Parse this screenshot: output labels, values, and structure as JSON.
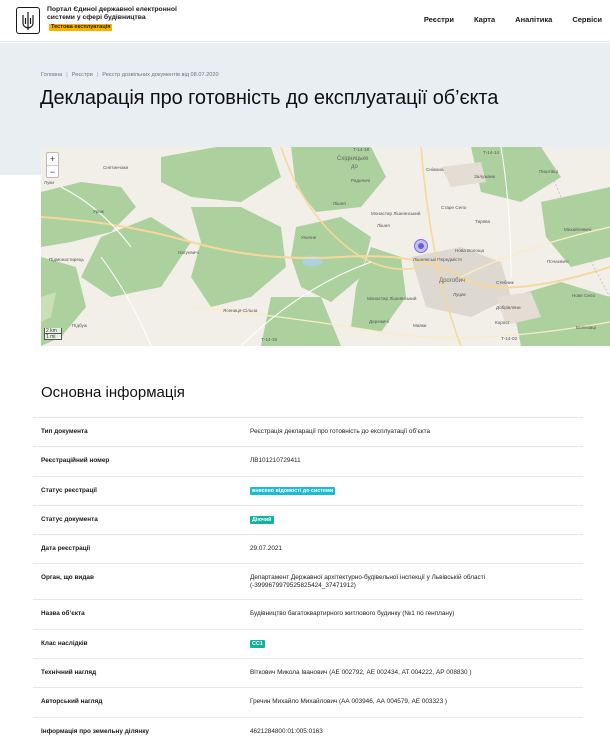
{
  "header": {
    "portal_title": "Портал Єдиної державної електронної системи у сфері будівництва",
    "test_badge": "Тестова експлуатація",
    "nav": [
      "Реєстри",
      "Карта",
      "Аналітика",
      "Сервіси"
    ]
  },
  "breadcrumb": [
    "Головна",
    "Реєстри",
    "Реєстр дозвільних документів від 08.07.2020"
  ],
  "page_title": "Декларація про готовність до експлуатації об’єкта",
  "map": {
    "zoom_in": "+",
    "zoom_out": "−",
    "scale_km": "2 km",
    "scale_mi": "1 mi",
    "labels": {
      "t1418": "Т-14-18",
      "t1414": "Т-14-14",
      "t1415": "Т-14-15",
      "t1402": "Т-14-02",
      "skhidnytske": "Східницьке",
      "do": "до",
      "lishnya_top": "Лішня",
      "lishnya_bottom": "Лішня",
      "uriz": "Урож",
      "pidmonastyrets": "Підмонастирець",
      "nahuievychi": "Нагуєвичі",
      "ulychne": "Уличне",
      "monastyr_top": "Монастир Лішнянський",
      "monastyr_bottom": "Монастир Лішнянський",
      "lishnianski_peredmistia": "Лішнянські Передмістя",
      "drohobych": "Дрогобич",
      "nova_volosha": "Нова Волоща",
      "tyrkova": "Тирява",
      "staryi_selo": "Старе Село",
      "pochayevychi": "Почаєвичі",
      "mykhailevychi": "Михайлевичі",
      "dobrovlyany": "Добрівляни",
      "korost": "Корост",
      "nove_selo": "Нове Село",
      "bolekhivtsi": "Болехівці",
      "stebnyk": "Стебник",
      "mainovo": "Маяки",
      "derezhychi": "Дережичі",
      "yasenytsia": "Ясениця-Сільна",
      "pidbuzh": "Підбуж",
      "zaluzhany": "Залужани",
      "lutsyk": "Луцик",
      "snizhana": "Сніжана",
      "radelych": "Раделичі",
      "pytrivtsi": "Пиштівці",
      "sanchaky": "Снятинчаки",
      "lukavytsi": "Луки"
    }
  },
  "section_title": "Основна інформація",
  "info": [
    {
      "label": "Тип документа",
      "value": "Реєстрація декларації про готовність до експлуатації об’єкта",
      "kind": "text"
    },
    {
      "label": "Реєстраційний номер",
      "value": "ЛВ101210729411",
      "kind": "text"
    },
    {
      "label": "Статус реєстрації",
      "value": "внесено відомості до системи",
      "kind": "badge-blue"
    },
    {
      "label": "Статус документа",
      "value": "Діючий",
      "kind": "badge-green"
    },
    {
      "label": "Дата реєстрації",
      "value": "29.07.2021",
      "kind": "text"
    },
    {
      "label": "Орган, що видав",
      "value": "Департамент Державної архітектурно-будівельної інспекції у Львівській області (-3999679979525825424_37471912)",
      "kind": "text"
    },
    {
      "label": "Назва об’єкта",
      "value": "Будівництво багатоквартирного житлового будинку (№1 по генплану)",
      "kind": "text"
    },
    {
      "label": "Клас наслідків",
      "value": "СС1",
      "kind": "badge-green"
    },
    {
      "label": "Технічний нагляд",
      "value": "Віткович Микола Іванович (АЕ 002792, АЕ 002434, АТ 004222, АР 008830 )",
      "kind": "text"
    },
    {
      "label": "Авторський нагляд",
      "value": "Гречин Михайло Михайлович (АА 003946, АА 004579, АЕ 003323 )",
      "kind": "text"
    },
    {
      "label": "Інформація про земельну ділянку",
      "value": "4621284800:01:005:0163",
      "kind": "text"
    }
  ]
}
